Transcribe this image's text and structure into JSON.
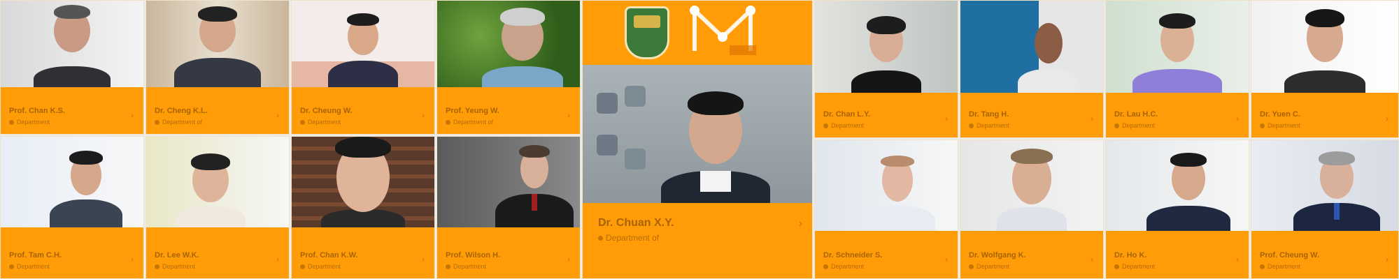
{
  "grid": {
    "featured": {
      "name": "Dr. Chuan X.Y.",
      "dept": "Department of"
    },
    "cards": [
      {
        "name": "Prof. Chan K.S.",
        "dept": "Department"
      },
      {
        "name": "Dr. Cheng K.L.",
        "dept": "Department of"
      },
      {
        "name": "Dr. Cheung W.",
        "dept": "Department"
      },
      {
        "name": "Prof. Yeung W.",
        "dept": "Department of"
      },
      {
        "name": "Dr. Chan L.Y.",
        "dept": "Department"
      },
      {
        "name": "Dr. Tang H.",
        "dept": "Department"
      },
      {
        "name": "Dr. Lau H.C.",
        "dept": "Department"
      },
      {
        "name": "Dr. Yuen C.",
        "dept": "Department"
      },
      {
        "name": "Prof. Tam C.H.",
        "dept": "Department"
      },
      {
        "name": "Dr. Lee W.K.",
        "dept": "Department"
      },
      {
        "name": "Prof. Chan K.W.",
        "dept": "Department"
      },
      {
        "name": "Prof. Wilson H.",
        "dept": "Department"
      },
      {
        "name": "Dr. Schneider S.",
        "dept": "Department"
      },
      {
        "name": "Dr. Wolfgang K.",
        "dept": "Department"
      },
      {
        "name": "Dr. Ho K.",
        "dept": "Department"
      },
      {
        "name": "Prof. Cheung W.",
        "dept": "Department"
      }
    ]
  },
  "colors": {
    "card_accent": "#ff9c07"
  }
}
